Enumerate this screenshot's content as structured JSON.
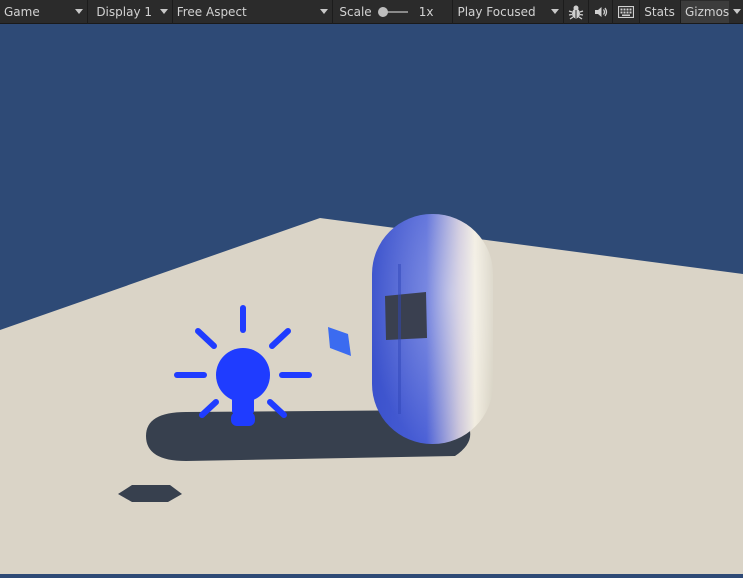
{
  "toolbar": {
    "view_select": "Game",
    "display_select": "Display 1",
    "aspect_select": "Free Aspect",
    "scale_label": "Scale",
    "scale_value": "1x",
    "scale_slider_level": 0.0,
    "play_mode_select": "Play Focused",
    "stats_label": "Stats",
    "gizmos_label": "Gizmos"
  },
  "icons": {
    "debug": "bug-icon",
    "audio": "speaker-icon",
    "keyboard": "keyboard-icon",
    "light": "lightbulb-icon"
  },
  "colors": {
    "sky": "#2e4a76",
    "ground": "#dad4c7",
    "shadow": "#37404e",
    "gizmo": "#1f3cff",
    "capsule_light": "#f1ecdf",
    "capsule_dark": "#3b52cc"
  }
}
